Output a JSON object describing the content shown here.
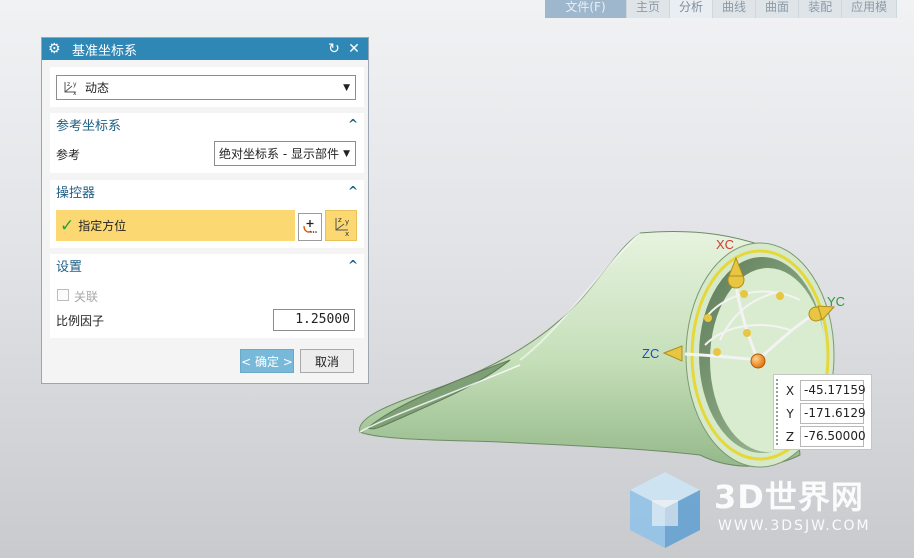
{
  "ribbon": {
    "tabs": [
      "文件(F)",
      "主页",
      "分析",
      "曲线",
      "曲面",
      "装配",
      "应用模"
    ],
    "active": "分析"
  },
  "dialog": {
    "title": "基准坐标系",
    "type_select": "动态",
    "section_ref": "参考坐标系",
    "ref_label": "参考",
    "ref_value": "绝对坐标系 - 显示部件",
    "section_manip": "操控器",
    "specify_orientation": "指定方位",
    "section_settings": "设置",
    "associative_label": "关联",
    "associative_checked": false,
    "scale_label": "比例因子",
    "scale_value": "1.25000",
    "ok_label": "< 确定 >",
    "cancel_label": "取消"
  },
  "viewport": {
    "axis_labels": {
      "xc": "XC",
      "yc": "YC",
      "zc": "ZC"
    },
    "coords": {
      "x_label": "X",
      "x": "-45.17159",
      "y_label": "Y",
      "y": "-171.6129",
      "z_label": "Z",
      "z": "-76.50000"
    }
  },
  "watermark": {
    "title": "3D世界网",
    "url": "WWW.3DSJW.COM"
  },
  "colors": {
    "title_bar": "#2f87b6",
    "section_header": "#1f5f86",
    "highlight": "#fbd872",
    "model_fill": "#c9e3bf",
    "ok_button": "#78b9d9",
    "x_axis": "#d23b2f",
    "y_axis": "#2a9c3a",
    "z_axis": "#1f4fbf"
  }
}
